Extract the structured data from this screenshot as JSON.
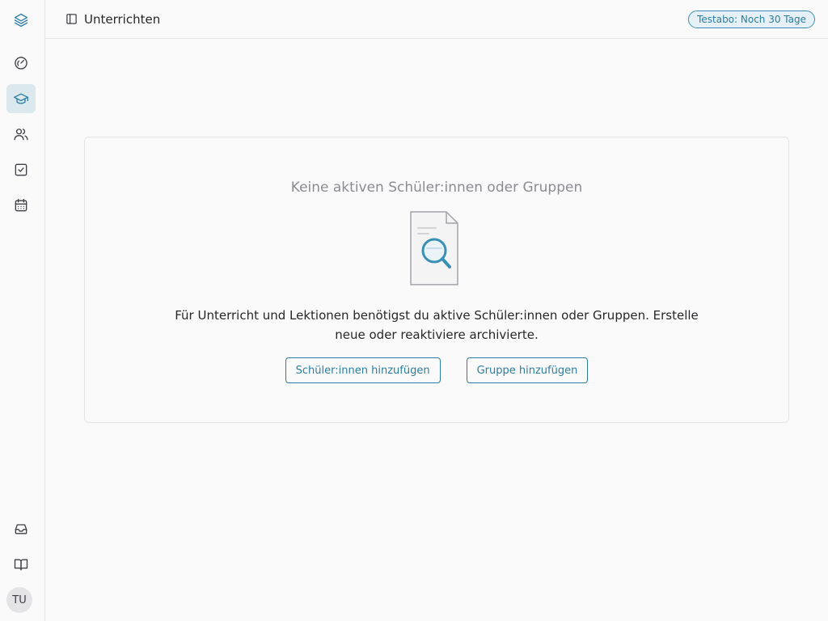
{
  "sidebar": {
    "items": [
      {
        "name": "layers-icon"
      },
      {
        "name": "dashboard-gauge-icon"
      },
      {
        "name": "graduation-cap-icon",
        "active": true
      },
      {
        "name": "users-icon"
      },
      {
        "name": "checkbox-icon"
      },
      {
        "name": "calendar-icon"
      }
    ],
    "bottom_items": [
      {
        "name": "inbox-icon"
      },
      {
        "name": "book-open-icon"
      }
    ],
    "avatar_initials": "TU"
  },
  "header": {
    "title": "Unterrichten",
    "trial_badge": "Testabo: Noch 30 Tage"
  },
  "empty_state": {
    "title": "Keine aktiven Schüler:innen oder Gruppen",
    "description": "Für Unterricht und Lektionen benötigst du aktive Schüler:innen oder Gruppen. Erstelle neue oder reaktiviere archivierte.",
    "add_students_label": "Schüler:innen hinzufügen",
    "add_group_label": "Gruppe hinzufügen"
  },
  "colors": {
    "accent": "#2b7da3",
    "active_nav_bg": "#dbe9ef",
    "border": "#e4e4e7",
    "background": "#fafafa"
  }
}
